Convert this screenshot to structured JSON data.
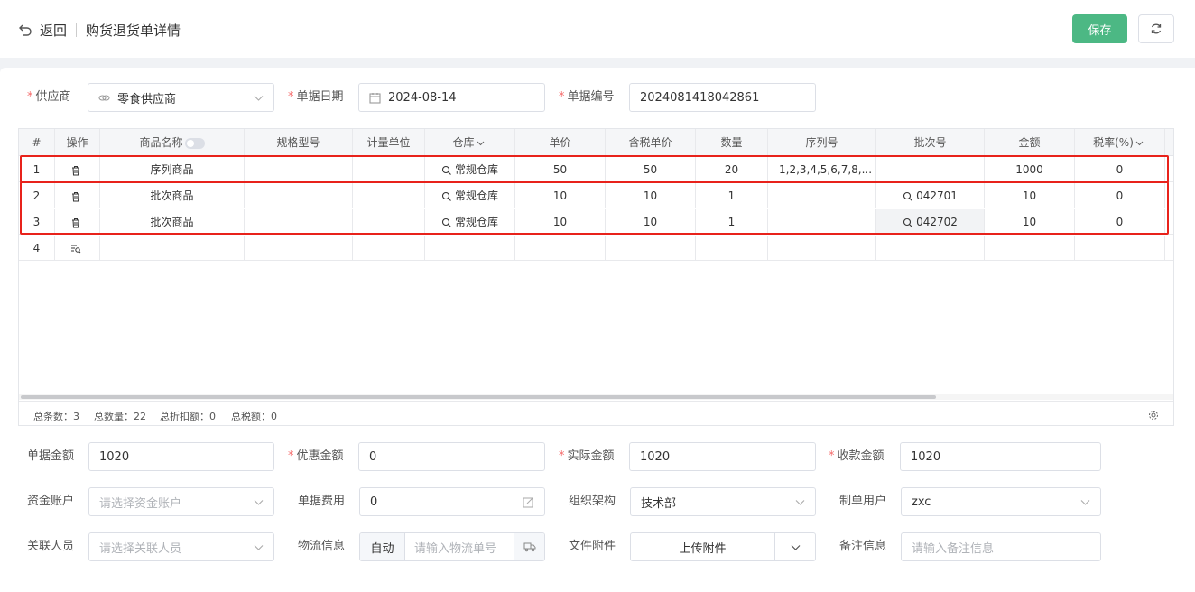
{
  "header": {
    "back_label": "返回",
    "title": "购货退货单详情",
    "save_label": "保存"
  },
  "form_top": {
    "supplier": {
      "label": "供应商",
      "value": "零食供应商"
    },
    "date": {
      "label": "单据日期",
      "value": "2024-08-14"
    },
    "number": {
      "label": "单据编号",
      "value": "2024081418042861"
    }
  },
  "table": {
    "columns": [
      "#",
      "操作",
      "商品名称",
      "规格型号",
      "计量单位",
      "仓库",
      "单价",
      "含税单价",
      "数量",
      "序列号",
      "批次号",
      "金额",
      "税率(%)"
    ],
    "rows": [
      {
        "idx": "1",
        "name": "序列商品",
        "spec": "",
        "unit": "",
        "warehouse": "常规仓库",
        "price": "50",
        "tax_price": "50",
        "qty": "20",
        "serial": "1,2,3,4,5,6,7,8,...",
        "batch": "",
        "amount": "1000",
        "tax_rate": "0"
      },
      {
        "idx": "2",
        "name": "批次商品",
        "spec": "",
        "unit": "",
        "warehouse": "常规仓库",
        "price": "10",
        "tax_price": "10",
        "qty": "1",
        "serial": "",
        "batch": "042701",
        "amount": "10",
        "tax_rate": "0"
      },
      {
        "idx": "3",
        "name": "批次商品",
        "spec": "",
        "unit": "",
        "warehouse": "常规仓库",
        "price": "10",
        "tax_price": "10",
        "qty": "1",
        "serial": "",
        "batch": "042702",
        "amount": "10",
        "tax_rate": "0"
      }
    ],
    "empty_row_idx": "4",
    "footer": {
      "total_count": "总条数：3",
      "total_qty": "总数量：22",
      "total_discount": "总折扣额：0",
      "total_tax": "总税额：0"
    }
  },
  "form_bottom": {
    "bill_amount": {
      "label": "单据金额",
      "value": "1020"
    },
    "discount_amount": {
      "label": "优惠金额",
      "value": "0"
    },
    "actual_amount": {
      "label": "实际金额",
      "value": "1020"
    },
    "received_amount": {
      "label": "收款金额",
      "value": "1020"
    },
    "fund_account": {
      "label": "资金账户",
      "placeholder": "请选择资金账户"
    },
    "bill_fee": {
      "label": "单据费用",
      "value": "0"
    },
    "org": {
      "label": "组织架构",
      "value": "技术部"
    },
    "creator": {
      "label": "制单用户",
      "value": "zxc"
    },
    "related_person": {
      "label": "关联人员",
      "placeholder": "请选择关联人员"
    },
    "logistics": {
      "label": "物流信息",
      "prefix": "自动",
      "placeholder": "请输入物流单号"
    },
    "attachment": {
      "label": "文件附件",
      "button": "上传附件"
    },
    "remark": {
      "label": "备注信息",
      "placeholder": "请输入备注信息"
    }
  }
}
